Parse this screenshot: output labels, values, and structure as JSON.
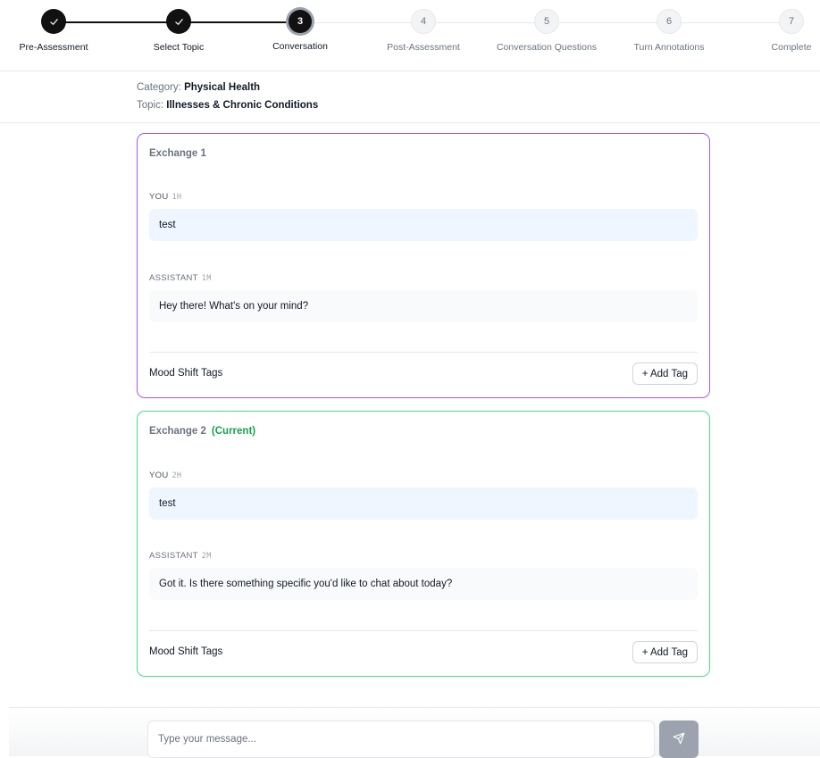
{
  "stepper": {
    "steps": [
      {
        "number": "1",
        "label": "Pre-Assessment",
        "state": "done"
      },
      {
        "number": "2",
        "label": "Select Topic",
        "state": "done"
      },
      {
        "number": "3",
        "label": "Conversation",
        "state": "current"
      },
      {
        "number": "4",
        "label": "Post-Assessment",
        "state": "todo"
      },
      {
        "number": "5",
        "label": "Conversation Questions",
        "state": "todo"
      },
      {
        "number": "6",
        "label": "Turn Annotations",
        "state": "todo"
      },
      {
        "number": "7",
        "label": "Complete",
        "state": "todo"
      }
    ]
  },
  "topic": {
    "category_prefix": "Category:",
    "category": "Physical Health",
    "topic_prefix": "Topic:",
    "topic": "Illnesses & Chronic Conditions"
  },
  "exchanges": [
    {
      "title": "Exchange 1",
      "current_label": "",
      "you_label": "YOU",
      "you_time": "1H",
      "you_text": "test",
      "assistant_label": "ASSISTANT",
      "assistant_time": "1M",
      "assistant_text": "Hey there! What's on your mind?",
      "tags_label": "Mood Shift Tags",
      "add_tag_label": "+ Add Tag",
      "border_color": "#a855f7"
    },
    {
      "title": "Exchange 2",
      "current_label": "(Current)",
      "you_label": "YOU",
      "you_time": "2H",
      "you_text": "test",
      "assistant_label": "ASSISTANT",
      "assistant_time": "2M",
      "assistant_text": "Got it. Is there something specific you'd like to chat about today?",
      "tags_label": "Mood Shift Tags",
      "add_tag_label": "+ Add Tag",
      "border_color": "#4ade80"
    }
  ],
  "composer": {
    "placeholder": "Type your message...",
    "value": "",
    "send_icon": "send-icon"
  },
  "colors": {
    "done_step": "#111111",
    "current_label": "#16a34a",
    "send_button": "#9ca3af"
  }
}
